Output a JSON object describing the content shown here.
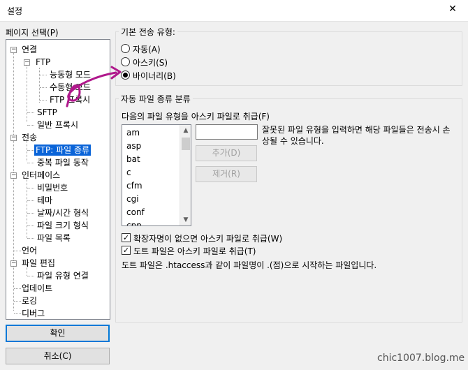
{
  "window": {
    "title": "설정",
    "close_glyph": "✕"
  },
  "sidebar": {
    "label": "페이지 선택(P)",
    "tree": [
      {
        "label": "연결"
      },
      {
        "label": "FTP"
      },
      {
        "label": "능동형 모드"
      },
      {
        "label": "수동형 모드"
      },
      {
        "label": "FTP 프록시"
      },
      {
        "label": "SFTP"
      },
      {
        "label": "일반 프록시"
      },
      {
        "label": "전송"
      },
      {
        "label": "FTP: 파일 종류"
      },
      {
        "label": "중복 파일 동작"
      },
      {
        "label": "인터페이스"
      },
      {
        "label": "비밀번호"
      },
      {
        "label": "테마"
      },
      {
        "label": "날짜/시간 형식"
      },
      {
        "label": "파일 크기 형식"
      },
      {
        "label": "파일 목록"
      },
      {
        "label": "언어"
      },
      {
        "label": "파일 편집"
      },
      {
        "label": "파일 유형 연결"
      },
      {
        "label": "업데이트"
      },
      {
        "label": "로깅"
      },
      {
        "label": "디버그"
      }
    ],
    "ok_label": "확인",
    "cancel_label": "취소(C)"
  },
  "transfer_type": {
    "title": "기본 전송 유형:",
    "options": [
      {
        "label": "자동(A)",
        "selected": false
      },
      {
        "label": "아스키(S)",
        "selected": false
      },
      {
        "label": "바이너리(B)",
        "selected": true
      }
    ]
  },
  "auto_type": {
    "title": "자동 파일 종류 분류",
    "ascii_label": "다음의 파일 유형을 아스키 파일로 취급(F)",
    "extensions": [
      "am",
      "asp",
      "bat",
      "c",
      "cfm",
      "cgi",
      "conf",
      "cpp"
    ],
    "input_value": "",
    "hint": "잘못된 파일 유형을 입력하면 해당 파일들은 전송시 손상될 수 있습니다.",
    "add_label": "추가(D)",
    "remove_label": "제거(R)",
    "check_no_ext": {
      "label": "확장자명이 없으면 아스키 파일로 취급(W)",
      "checked": true
    },
    "check_dotfiles": {
      "label": "도트 파일은 아스키 파일로 취급(T)",
      "checked": true
    },
    "footnote": "도트 파일은 .htaccess과 같이 파일명이 .(점)으로 시작하는 파일입니다."
  },
  "watermark": "chic1007.blog.me",
  "colors": {
    "selection": "#0a64d8",
    "annotation": "#b0188c",
    "default_button_border": "#0078d7"
  }
}
